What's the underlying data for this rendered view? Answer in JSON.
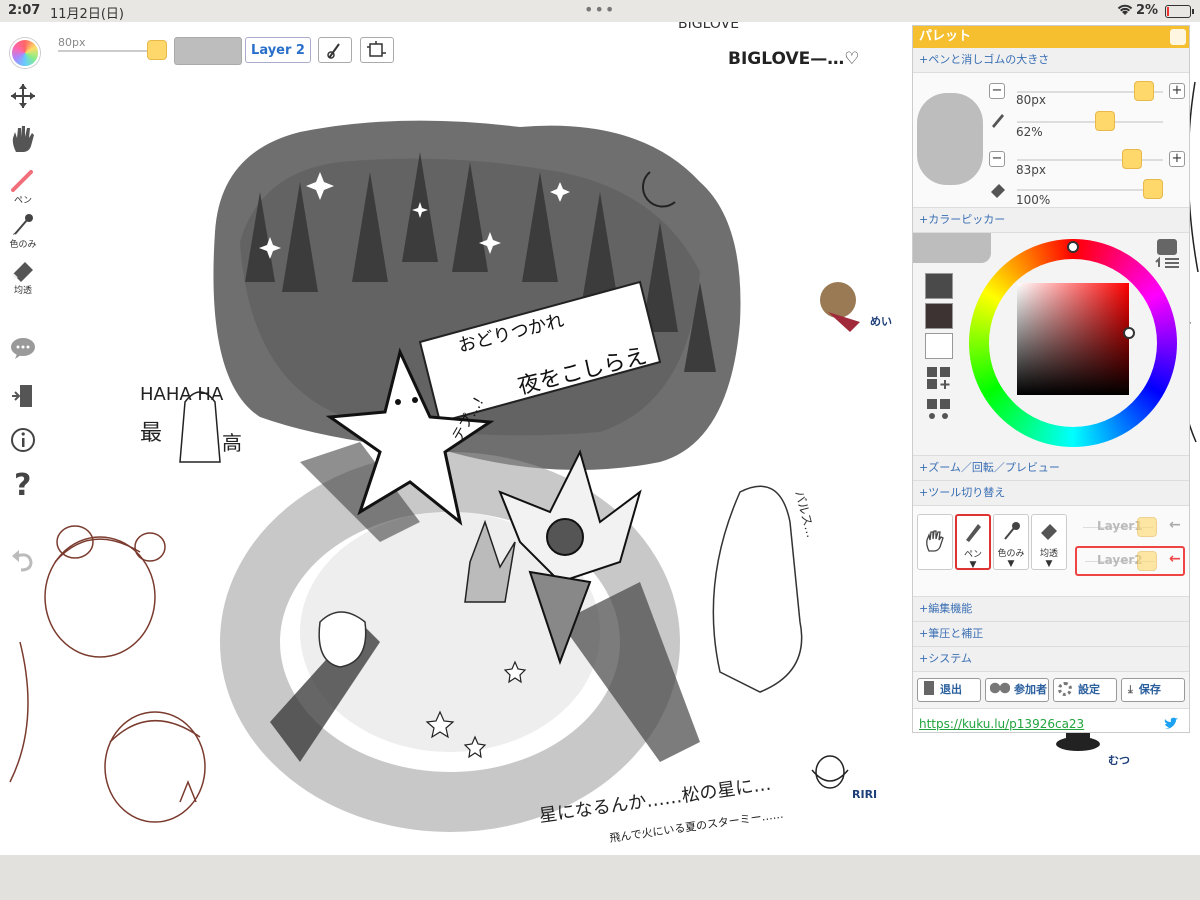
{
  "status": {
    "time": "2:07",
    "date": "11月2日(日)",
    "battery": "2%"
  },
  "toolbar": {
    "size_label": "80px",
    "layer_button": "Layer 2"
  },
  "left_tools": {
    "pen_label": "ペン",
    "eyedropper_label": "色のみ",
    "eraser_label": "均透"
  },
  "canvas_text": {
    "biglove_top": "BIGLOVE",
    "biglove": "BIGLOVE—…♡",
    "mei": "めい",
    "riri": "RIRI",
    "mutsu": "むつ",
    "haha": "HAHA HA",
    "sai": "最",
    "kou": "高",
    "banner1": "おどりつかれ",
    "banner2": "夜をこしらえ",
    "tepu": "テプ…!",
    "caption1": "星になるんか……松の星に…",
    "caption2": "飛んで火にいる夏のスターミー……",
    "barusu": "バルス…"
  },
  "palette": {
    "title": "パレット",
    "sec_pen_size": "+ペンと消しゴムの大きさ",
    "pen_size": "80px",
    "pen_opacity": "62%",
    "eraser_size": "83px",
    "eraser_opacity": "100%",
    "pen_size_frac": 0.93,
    "pen_opacity_frac": 0.62,
    "eraser_size_frac": 0.83,
    "eraser_opacity_frac": 1.0,
    "sec_color_picker": "+カラーピッカー",
    "swatches": [
      "#4a4a4a",
      "#3d3333",
      "#ffffff"
    ],
    "sec_zoom": "+ズーム／回転／プレビュー",
    "sec_tool_switch": "+ツール切り替え",
    "tools": {
      "pen": "ペン",
      "eyedropper": "色のみ",
      "eraser": "均透"
    },
    "layers": [
      "Layer1",
      "Layer2"
    ],
    "sec_edit": "+編集機能",
    "sec_pressure": "+筆圧と補正",
    "sec_system": "+システム",
    "actions": {
      "exit": "退出",
      "participants": "参加者",
      "settings": "設定",
      "save": "保存"
    },
    "link": "https://kuku.lu/p13926ca23"
  },
  "colors": {
    "accent": "#f5bf2f",
    "knob": "#ffd86b",
    "link": "#21a33e",
    "label_blue": "#3a6fb4"
  }
}
